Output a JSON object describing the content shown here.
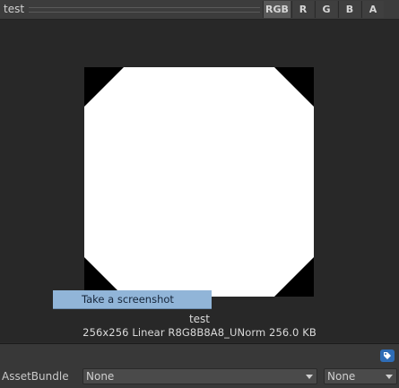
{
  "header": {
    "title": "test",
    "channels": [
      {
        "label": "RGB",
        "active": true
      },
      {
        "label": "R",
        "active": false
      },
      {
        "label": "G",
        "active": false
      },
      {
        "label": "B",
        "active": false
      },
      {
        "label": "A",
        "active": false
      }
    ]
  },
  "preview": {
    "context_menu_item": "Take a screenshot",
    "texture_name": "test",
    "texture_info": "256x256 Linear  R8G8B8A8_UNorm  256.0 KB"
  },
  "asset_bundle": {
    "label": "AssetBundle",
    "name_value": "None",
    "variant_value": "None"
  },
  "icons": {
    "tag": "tag-icon"
  },
  "colors": {
    "accent": "#2f6db6",
    "context_highlight": "#91b5d8",
    "texture_fill": "#ffffff",
    "texture_corner": "#000000"
  }
}
